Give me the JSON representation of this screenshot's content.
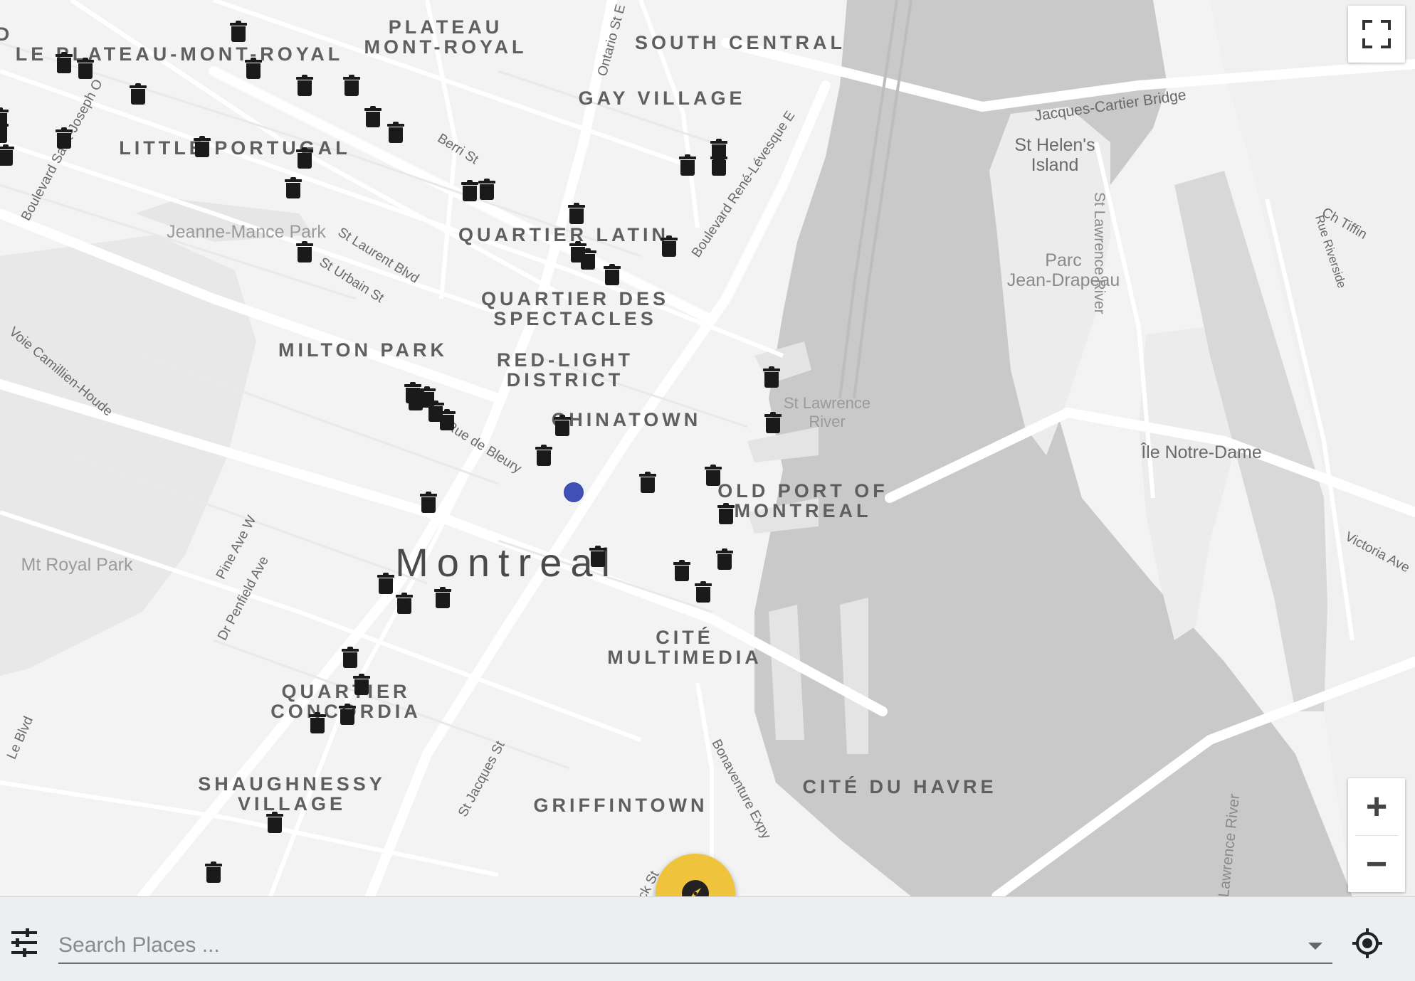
{
  "map": {
    "city_label": "Montreal",
    "districts": [
      {
        "id": "plateau-mont-royal",
        "text": "PLATEAU\nMONT-ROYAL"
      },
      {
        "id": "le-plateau",
        "text": "LE PLATEAU-MONT-ROYAL"
      },
      {
        "id": "south-central",
        "text": "SOUTH CENTRAL"
      },
      {
        "id": "gay-village",
        "text": "GAY VILLAGE"
      },
      {
        "id": "little-portugal",
        "text": "LITTLE PORTUGAL"
      },
      {
        "id": "quartier-latin",
        "text": "QUARTIER LATIN"
      },
      {
        "id": "quartier-des-spectacles",
        "text": "QUARTIER DES\nSPECTACLES"
      },
      {
        "id": "milton-park",
        "text": "MILTON PARK"
      },
      {
        "id": "red-light",
        "text": "RED-LIGHT\nDISTRICT"
      },
      {
        "id": "chinatown",
        "text": "CHINATOWN"
      },
      {
        "id": "old-port",
        "text": "OLD PORT OF\nMONTREAL"
      },
      {
        "id": "cite-multimedia",
        "text": "CITÉ\nMULTIMEDIA"
      },
      {
        "id": "quartier-concordia",
        "text": "QUARTIER\nCONCORDIA"
      },
      {
        "id": "shaughnessy",
        "text": "SHAUGHNESSY\nVILLAGE"
      },
      {
        "id": "griffintown",
        "text": "GRIFFINTOWN"
      },
      {
        "id": "cite-du-havre",
        "text": "CITÉ DU HAVRE"
      },
      {
        "id": "edge-d",
        "text": "D"
      }
    ],
    "parks": [
      {
        "id": "jeanne-mance",
        "text": "Jeanne-Mance Park"
      },
      {
        "id": "mt-royal",
        "text": "Mt Royal Park"
      },
      {
        "id": "parc-jean-drapeau",
        "text": "Parc\nJean-Drapeau"
      }
    ],
    "islands": [
      {
        "id": "st-helens",
        "text": "St Helen's\nIsland"
      },
      {
        "id": "ile-notre-dame",
        "text": "Île Notre-Dame"
      }
    ],
    "water_labels": [
      {
        "id": "st-lawrence-1",
        "text": "St Lawrence\nRiver"
      },
      {
        "id": "st-lawrence-2",
        "text": "St Lawrence River"
      },
      {
        "id": "st-lawrence-3",
        "text": "Lawrence River"
      }
    ],
    "streets": [
      {
        "id": "ontario-st",
        "text": "Ontario St E"
      },
      {
        "id": "berri-st",
        "text": "Berri St"
      },
      {
        "id": "rene-levesque",
        "text": "Boulevard René-Lévesque E"
      },
      {
        "id": "saint-joseph",
        "text": "Boulevard Saint-Joseph O"
      },
      {
        "id": "st-laurent",
        "text": "St Laurent Blvd"
      },
      {
        "id": "st-urbain",
        "text": "St Urbain St"
      },
      {
        "id": "camillien-houde",
        "text": "Voie Camillien-Houde"
      },
      {
        "id": "de-bleury",
        "text": "Rue de Bleury"
      },
      {
        "id": "pine-ave",
        "text": "Pine Ave W"
      },
      {
        "id": "penfield",
        "text": "Dr Penfield Ave"
      },
      {
        "id": "st-jacques",
        "text": "St Jacques St"
      },
      {
        "id": "bonaventure",
        "text": "Bonaventure Expy"
      },
      {
        "id": "jacques-cartier-bridge",
        "text": "Jacques-Cartier Bridge"
      },
      {
        "id": "ch-tiffin",
        "text": "Ch Tiffin"
      },
      {
        "id": "rue-riverside",
        "text": "Rue Riverside"
      },
      {
        "id": "victoria-ave",
        "text": "Victoria Ave"
      },
      {
        "id": "le-blvd",
        "text": "Le Blvd"
      },
      {
        "id": "wick-st",
        "text": "ick St"
      }
    ],
    "trash_marker_count": 53
  },
  "controls": {
    "fullscreen_icon": "fullscreen-icon",
    "zoom_in_label": "+",
    "zoom_out_label": "−"
  },
  "bottom_bar": {
    "search_placeholder": "Search Places ...",
    "search_value": "",
    "filter_icon": "tune-icon",
    "locate_icon": "my-location-icon",
    "compass_icon": "compass-icon"
  },
  "colors": {
    "fab": "#f0c33c",
    "user_location": "#3f51b5",
    "marker": "#1a1a1a",
    "water": "#c9c9c9",
    "land": "#f3f3f3"
  }
}
